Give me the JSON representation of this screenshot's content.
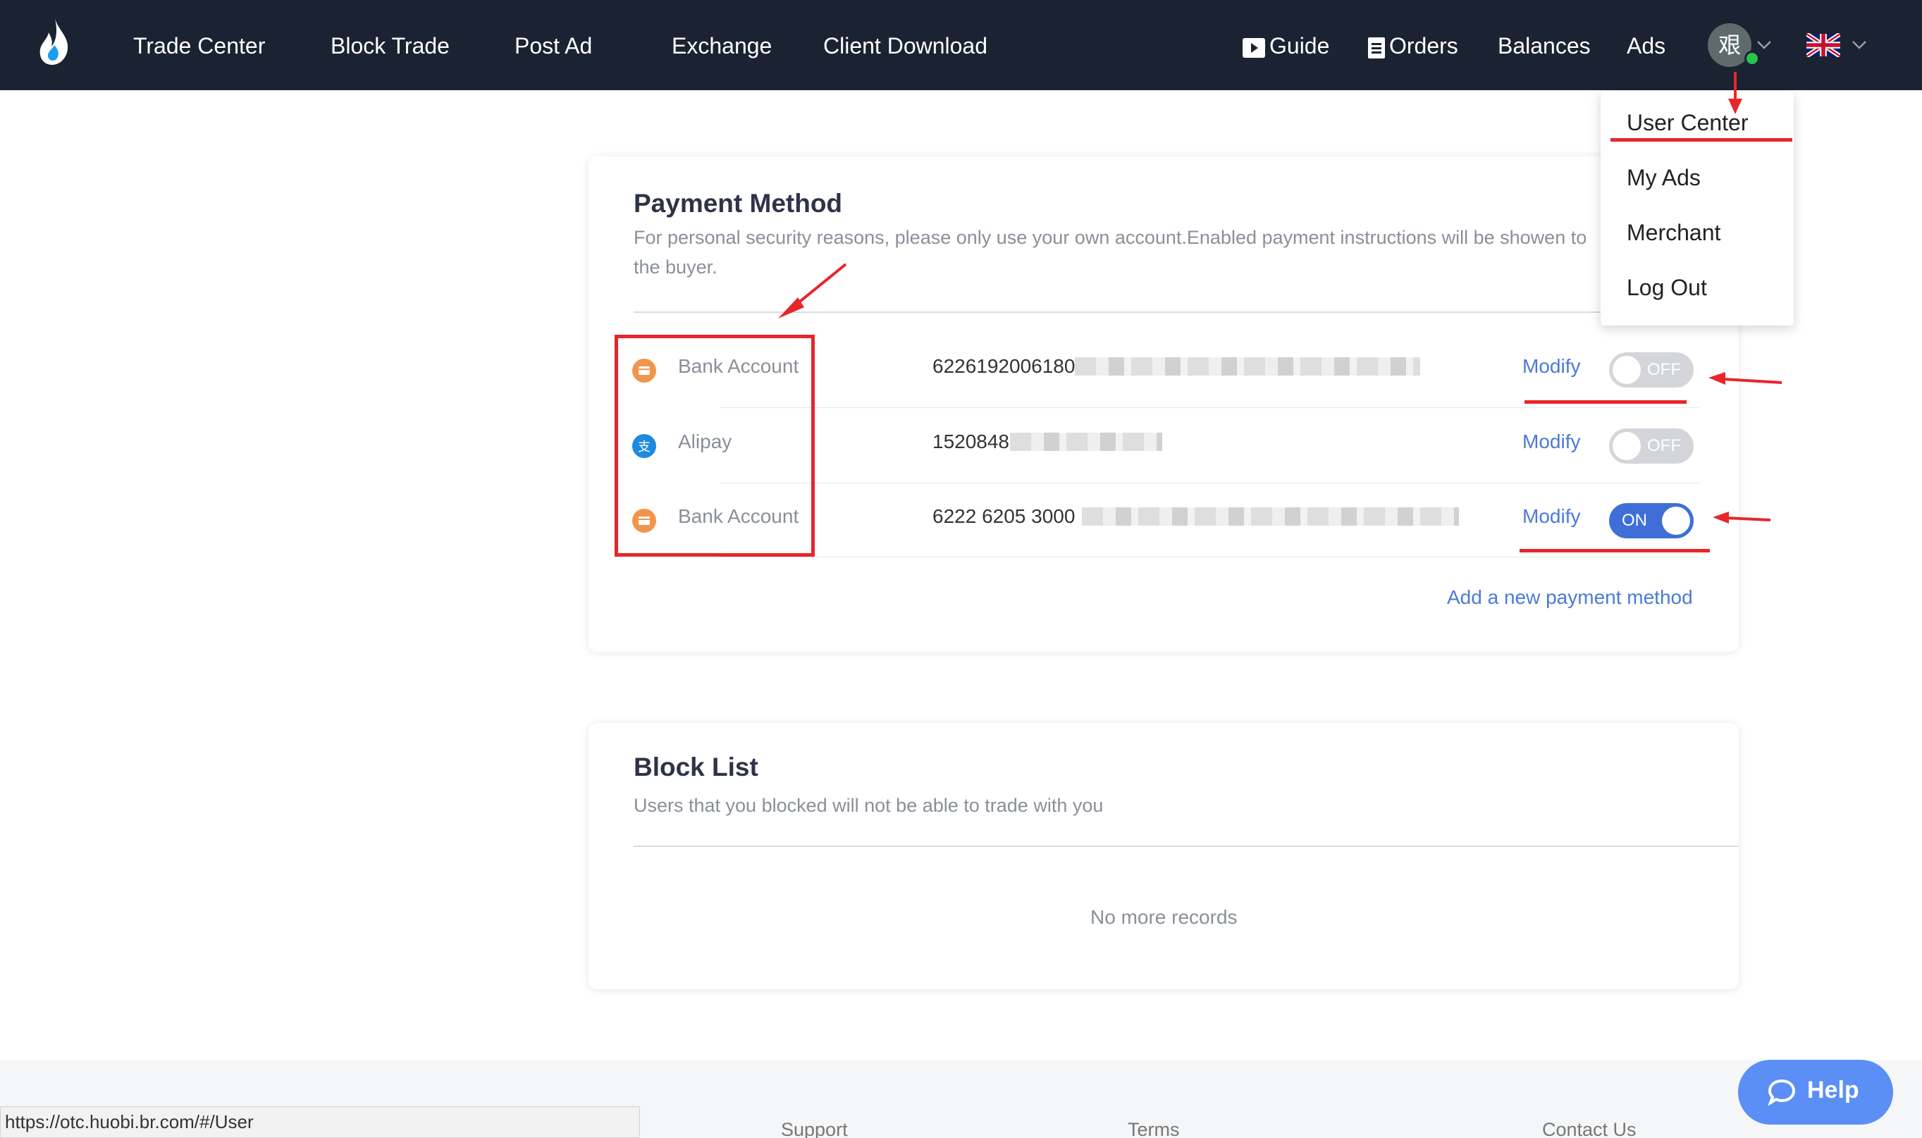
{
  "nav": {
    "items": [
      "Trade Center",
      "Block Trade",
      "Post Ad",
      "Exchange",
      "Client Download"
    ],
    "right": {
      "guide": "Guide",
      "orders": "Orders",
      "balances": "Balances",
      "ads": "Ads"
    },
    "avatar_char": "艰"
  },
  "user_menu": [
    "User Center",
    "My Ads",
    "Merchant",
    "Log Out"
  ],
  "payment": {
    "title": "Payment Method",
    "description": "For personal security reasons, please only use your own account.Enabled payment instructions will be showen to the buyer.",
    "methods": [
      {
        "name": "Bank Account",
        "account": "6226192006180",
        "modify": "Modify",
        "status": "OFF",
        "enabled": false,
        "icon": "bank-card-icon"
      },
      {
        "name": "Alipay",
        "account": "1520848",
        "modify": "Modify",
        "status": "OFF",
        "enabled": false,
        "icon": "alipay-icon"
      },
      {
        "name": "Bank Account",
        "account": "6222 6205 3000",
        "modify": "Modify",
        "status": "ON",
        "enabled": true,
        "icon": "bank-card-icon"
      }
    ],
    "add_link": "Add a new payment method"
  },
  "blocklist": {
    "title": "Block List",
    "description": "Users that you blocked will not be able to trade with you",
    "empty": "No more records"
  },
  "footer": {
    "links": [
      "Support",
      "Terms",
      "Contact Us"
    ]
  },
  "status_url": "https://otc.huobi.br.com/#/User",
  "help_label": "Help",
  "colors": {
    "nav_bg": "#1b2231",
    "accent": "#4a7ad8",
    "toggle_on": "#3f6fd6",
    "annotation": "#e8262a"
  }
}
